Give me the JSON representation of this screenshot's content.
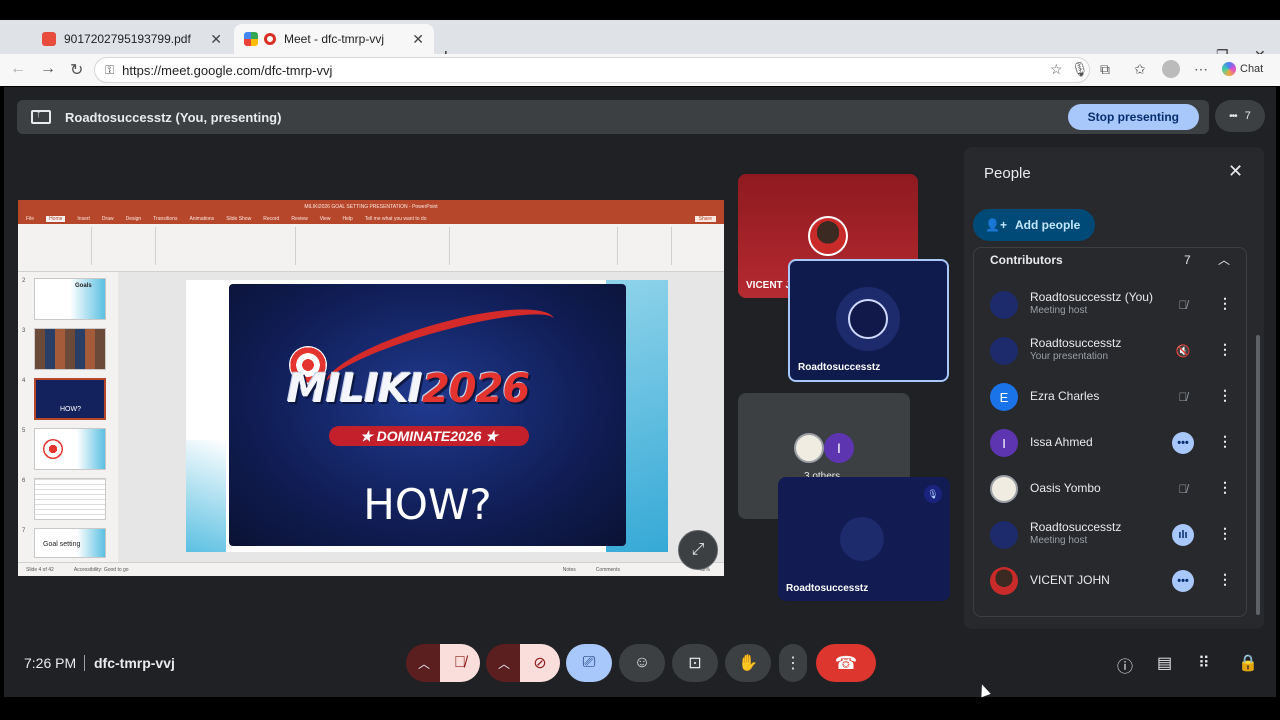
{
  "browser": {
    "tabs": [
      {
        "label": "9017202795193799.pdf",
        "active": false
      },
      {
        "label": "Meet - dfc-tmrp-vvj",
        "active": true
      }
    ],
    "url": "https://meet.google.com/dfc-tmrp-vvj",
    "chat_label": "Chat",
    "new_tab": "+",
    "close": "✕"
  },
  "presenting": {
    "label": "Roadtosuccesstz (You, presenting)",
    "stop_label": "Stop presenting",
    "participant_count": "7"
  },
  "slide": {
    "title_main": "MILIKI",
    "title_year": "2026",
    "banner": "★ DOMINATE2026 ★",
    "question": "HOW?",
    "ppt_window_title": "MILIKI2026 GOAL SETTING PRESENTATION - PowerPoint",
    "menu": [
      "File",
      "Home",
      "Insert",
      "Draw",
      "Design",
      "Transitions",
      "Animations",
      "Slide Show",
      "Record",
      "Review",
      "View",
      "Help",
      "Tell me what you want to do"
    ],
    "share_label": "Share",
    "thumb_numbers": [
      "2",
      "3",
      "4",
      "5",
      "6",
      "7"
    ],
    "thumb_texts": [
      "Goals",
      "",
      "HOW?",
      "",
      "",
      "Goal setting"
    ],
    "status_left": "Slide 4 of 42",
    "status_access": "Accessibility: Good to go",
    "status_notes": "Notes",
    "status_comments": "Comments",
    "zoom": "62%"
  },
  "tiles": [
    {
      "name": "VICENT J"
    },
    {
      "name": "Roadtosuccesstz"
    },
    {
      "name": "3 others"
    },
    {
      "name": "Roadtosuccesstz"
    }
  ],
  "people_panel": {
    "title": "People",
    "add_label": "Add people",
    "section": "Contributors",
    "count": "7",
    "people": [
      {
        "name": "Roadtosuccesstz (You)",
        "sub": "Meeting host",
        "status": "muted"
      },
      {
        "name": "Roadtosuccesstz",
        "sub": "Your presentation",
        "status": "presenting"
      },
      {
        "name": "Ezra Charles",
        "sub": "",
        "status": "muted",
        "initial": "E"
      },
      {
        "name": "Issa Ahmed",
        "sub": "",
        "status": "active",
        "initial": "I"
      },
      {
        "name": "Oasis Yombo",
        "sub": "",
        "status": "muted"
      },
      {
        "name": "Roadtosuccesstz",
        "sub": "Meeting host",
        "status": "speaking"
      },
      {
        "name": "VICENT JOHN",
        "sub": "",
        "status": "active"
      }
    ]
  },
  "bottom": {
    "time": "7:26 PM",
    "meeting_code": "dfc-tmrp-vvj"
  },
  "colors": {
    "meet_bg": "#202124",
    "accent_blue": "#a8c7fa",
    "end_call_red": "#dc362e",
    "ppt_red": "#b7472a"
  }
}
